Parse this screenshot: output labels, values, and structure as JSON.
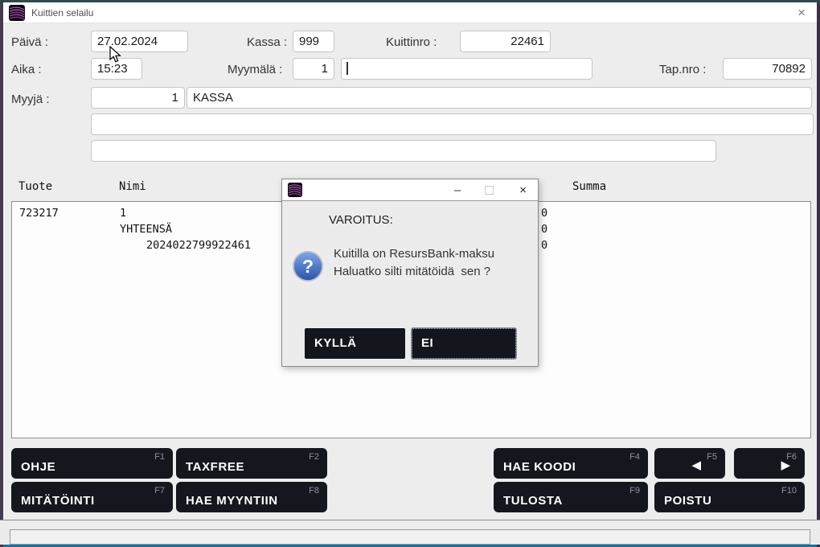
{
  "window": {
    "title": "Kuittien selailu",
    "close_glyph": "×"
  },
  "form": {
    "paiva_label": "Päivä :",
    "paiva_value": "27.02.2024",
    "kassa_label": "Kassa :",
    "kassa_value": "999",
    "kuittinro_label": "Kuittinro :",
    "kuittinro_value": "22461",
    "aika_label": "Aika :",
    "aika_value": "15:23",
    "myymala_label": "Myymälä :",
    "myymala_value": "1",
    "myymala_name": "",
    "tapnro_label": "Tap.nro :",
    "tapnro_value": "70892",
    "myyja_label": "Myyjä :",
    "myyja_value": "1",
    "myyja_name": "KASSA",
    "extra_row1": "",
    "extra_row2": ""
  },
  "table": {
    "headers": {
      "tuote": "Tuote",
      "nimi": "Nimi",
      "summa": "Summa"
    },
    "rows": [
      {
        "tuote": "723217",
        "nimi": "1",
        "indent": "",
        "partial": "0"
      },
      {
        "tuote": "",
        "nimi": "YHTEENSÄ",
        "indent": "",
        "partial": "0"
      },
      {
        "tuote": "",
        "nimi": "",
        "indent": "2024022799922461",
        "partial": "0"
      }
    ]
  },
  "dialog": {
    "heading": "VAROITUS:",
    "line1": "Kuitilla on ResursBank-maksu",
    "line2": "Haluatko silti mitätöidä  sen ?",
    "yes_label": "KYLLÄ",
    "no_label": "EI",
    "minimize_glyph": "–",
    "close_glyph": "×"
  },
  "function_buttons": [
    {
      "label": "OHJE",
      "fkey": "F1"
    },
    {
      "label": "TAXFREE",
      "fkey": "F2"
    },
    {
      "label": "HAE KOODI",
      "fkey": "F4"
    },
    {
      "label": "",
      "fkey": "F5",
      "glyph": "◀"
    },
    {
      "label": "",
      "fkey": "F6",
      "glyph": "▶"
    },
    {
      "label": "MITÄTÖINTI",
      "fkey": "F7"
    },
    {
      "label": "HAE MYYNTIIN",
      "fkey": "F8"
    },
    {
      "label": "TULOSTA",
      "fkey": "F9"
    },
    {
      "label": "POISTU",
      "fkey": "F10"
    }
  ],
  "colors": {
    "button_dark": "#15171f",
    "border_top": "#2e4a4b",
    "border_left": "#463a4e",
    "border_bottom": "#1d7099",
    "logo_purple": "#c05ecc",
    "question_blue": "#3566c4"
  }
}
